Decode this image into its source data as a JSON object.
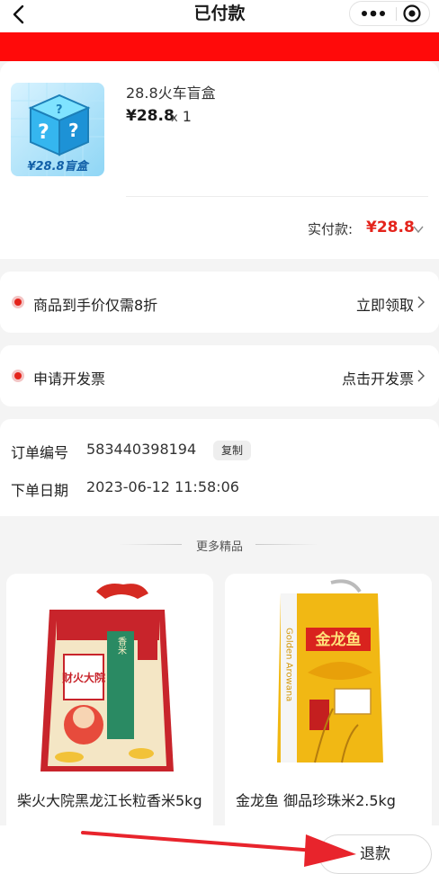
{
  "header": {
    "title": "已付款"
  },
  "product": {
    "name": "28.8火车盲盒",
    "price": "¥28.8",
    "qty_prefix": "x",
    "qty": "1",
    "thumb_caption": "¥28.8盲盒"
  },
  "payment": {
    "label": "实付款:",
    "amount": "¥28.8"
  },
  "coupon": {
    "label": "商品到手价仅需8折",
    "action": "立即领取"
  },
  "invoice": {
    "label": "申请开发票",
    "action": "点击开发票"
  },
  "order": {
    "number_label": "订单编号",
    "number": "583440398194",
    "copy_label": "复制",
    "date_label": "下单日期",
    "date": "2023-06-12 11:58:06"
  },
  "more": {
    "title": "更多精品",
    "items": [
      {
        "name": "柴火大院黑龙江长粒香米5kg",
        "package_text": "财火大院"
      },
      {
        "name": "金龙鱼 御品珍珠米2.5kg",
        "package_text": "金龙鱼"
      }
    ]
  },
  "footer": {
    "refund_label": "退款"
  },
  "colors": {
    "accent": "#e4241c",
    "band": "#ff0a0a",
    "annotation_arrow": "#e8242c"
  }
}
